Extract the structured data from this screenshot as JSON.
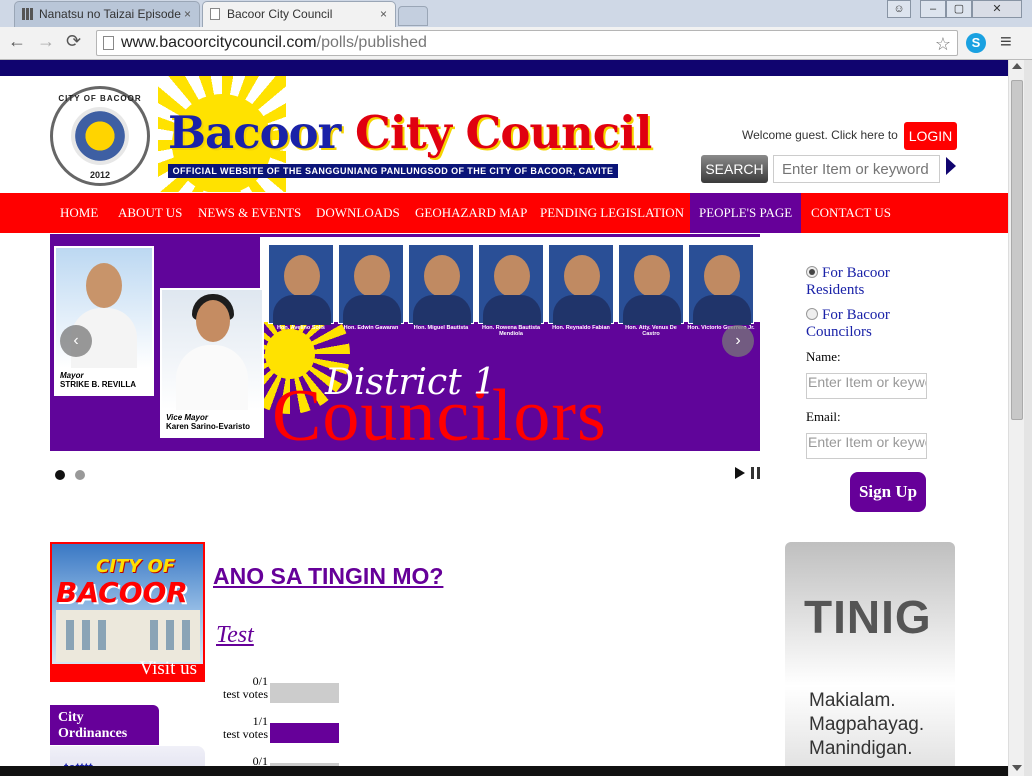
{
  "browser": {
    "tabs": [
      {
        "title": "Nanatsu no Taizai Episode",
        "close": "×"
      },
      {
        "title": "Bacoor City Council",
        "close": "×"
      }
    ],
    "url_host": "www.bacoorcitycouncil.com",
    "url_path": "/polls/published",
    "back": "←",
    "forward": "→",
    "reload": "⟳",
    "star": "☆",
    "menu": "≡",
    "skype_letter": "S",
    "win_min": "–",
    "win_max": "▢",
    "win_close": "✕",
    "win_user": "☺"
  },
  "header": {
    "seal_top": "CITY OF BACOOR",
    "seal_year": "2012",
    "title_part1": "Bacoor ",
    "title_part2": "City Council",
    "subtitle": "OFFICIAL WEBSITE OF THE SANGGUNIANG PANLUNGSOD OF THE CITY OF BACOOR, CAVITE",
    "welcome": "Welcome guest. Click here to",
    "login": "LOGIN",
    "search_button": "SEARCH",
    "search_placeholder": "Enter Item or keyword"
  },
  "nav": {
    "items": [
      "HOME",
      "ABOUT US",
      "NEWS & EVENTS",
      "DOWNLOADS",
      "GEOHAZARD MAP",
      "PENDING LEGISLATION",
      "PEOPLE'S PAGE",
      "CONTACT US"
    ],
    "active_index": 6
  },
  "slider": {
    "councilors": [
      "Hon. Avelino Solis",
      "Hon. Edwin Gawaran",
      "Hon. Miguel Bautista",
      "Hon. Rowena Bautista Mendiola",
      "Hon. Reynaldo Fabian",
      "Hon. Atty. Venus De Castro",
      "Hon. Victorio Guerrero Jr."
    ],
    "mayor_role": "Mayor",
    "mayor_name": "STRIKE B. REVILLA",
    "vice_mayor_role": "Vice Mayor",
    "vice_mayor_name": "Karen Sarino-Evaristo",
    "district": "District 1",
    "councilors_word": "Councilors",
    "prev": "‹",
    "next": "›",
    "active_dot": 0
  },
  "sidebar_form": {
    "option1": "For Bacoor Residents",
    "option2": "For Bacoor Councilors",
    "name_label": "Name:",
    "name_placeholder": "Enter Item or keyword",
    "email_label": "Email:",
    "email_placeholder": "Enter Item or keyword",
    "signup": "Sign Up"
  },
  "ad": {
    "city_of": "CITY OF",
    "bacoor": "BACOOR",
    "visit": "Visit us"
  },
  "poll": {
    "title": "ANO SA TINGIN MO?",
    "question": "Test",
    "rows": [
      {
        "count": "0/1",
        "label": "test votes",
        "fraction": 0
      },
      {
        "count": "1/1",
        "label": "test votes",
        "fraction": 1
      },
      {
        "count": "0/1",
        "label": "",
        "fraction": 0
      }
    ]
  },
  "ordinances": {
    "title": "City Ordinances",
    "first_item": "tetttt"
  },
  "tinig": {
    "title": "TINIG",
    "lines": [
      "Makialam.",
      "Magpahayag.",
      "Manindigan."
    ]
  },
  "colors": {
    "brand_red": "#ff0000",
    "brand_purple": "#660099",
    "brand_navy": "#10046f"
  }
}
